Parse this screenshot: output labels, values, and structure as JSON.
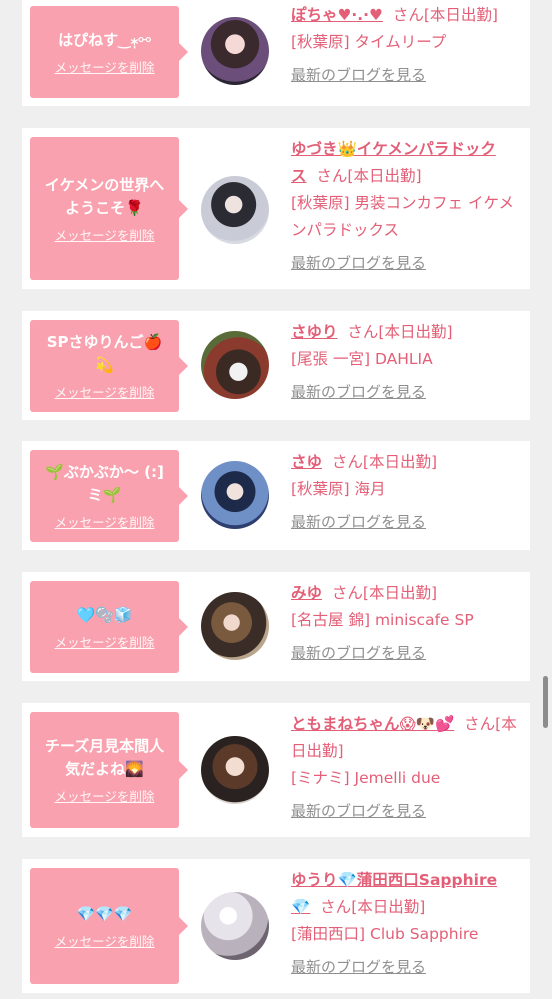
{
  "colors": {
    "accent": "#e35f77",
    "bubble": "#f9a1ae",
    "link_gray": "#8f8f8f"
  },
  "delete_label": "メッセージを削除",
  "blog_label": "最新のブログを見る",
  "entries": [
    {
      "message": [
        "はぴねす‿⁎̩⚯"
      ],
      "name": "ぽちゃ♥·.·♥",
      "san": "さん",
      "status": "[本日出勤]",
      "shop": "[秋葉原] タイムリープ"
    },
    {
      "message": [
        "イケメンの世界へ",
        "ようこそ🌹"
      ],
      "name": "ゆづき👑イケメンパラドックス",
      "san": "さん",
      "status": "[本日出勤]",
      "shop": "[秋葉原] 男装コンカフェ イケメンパラドックス"
    },
    {
      "message": [
        "SPさゆりんご🍎",
        "💫"
      ],
      "name": "さゆり",
      "san": "さん",
      "status": "[本日出勤]",
      "shop": "[尾張 一宮] DAHLIA"
    },
    {
      "message": [
        "🌱ぶかぶか〜 (:]",
        "ミ🌱"
      ],
      "name": "さゆ",
      "san": "さん",
      "status": "[本日出勤]",
      "shop": "[秋葉原] 海月"
    },
    {
      "message": [
        "🩵🫧🧊"
      ],
      "name": "みゆ",
      "san": "さん",
      "status": "[本日出勤]",
      "shop": "[名古屋 錦] miniscafe SP"
    },
    {
      "message": [
        "チーズ月見本間人",
        "気だよね🌄"
      ],
      "name": "ともまねちゃん😱🐶💕",
      "san": "さん",
      "status": "[本日出勤]",
      "shop": "[ミナミ] Jemelli due"
    },
    {
      "message": [
        "💎💎💎"
      ],
      "name": "ゆうり💎蒲田西口Sapphire💎",
      "san": "さん",
      "status": "[本日出勤]",
      "shop": "[蒲田西口] Club Sapphire"
    }
  ]
}
